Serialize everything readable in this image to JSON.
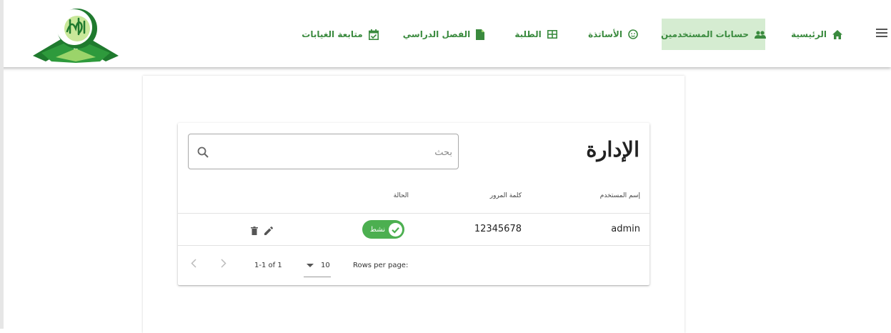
{
  "nav": {
    "menu_icon": "menu-icon",
    "items": [
      {
        "label": "الرئيسية",
        "icon": "home-icon",
        "active": false
      },
      {
        "label": "حسابات المستخدمين",
        "icon": "people-icon",
        "active": true
      },
      {
        "label": "الأساتذة",
        "icon": "face-icon",
        "active": false
      },
      {
        "label": "الطلبة",
        "icon": "table-icon",
        "active": false
      },
      {
        "label": "الفصل الدراسي",
        "icon": "file-icon",
        "active": false
      },
      {
        "label": "متابعة الغيابات",
        "icon": "calendar-check-icon",
        "active": false
      }
    ]
  },
  "colors": {
    "accent": "#3a8a3e",
    "active_bg": "#d5ecd1",
    "status_active": "#4caf50"
  },
  "admin_table": {
    "title": "الإدارة",
    "search": {
      "placeholder": "بحث",
      "value": "",
      "icon": "search-icon"
    },
    "columns": [
      "إسم المستخدم",
      "كلمة المرور",
      "الحالة"
    ],
    "rows": [
      {
        "username": "admin",
        "password": "12345678",
        "status": "نشط",
        "actions": [
          "edit-icon",
          "delete-icon"
        ]
      }
    ],
    "pagination": {
      "rows_per_page_label": "Rows per page:",
      "rows_per_page": "10",
      "range_text": "1-1 of 1"
    }
  }
}
